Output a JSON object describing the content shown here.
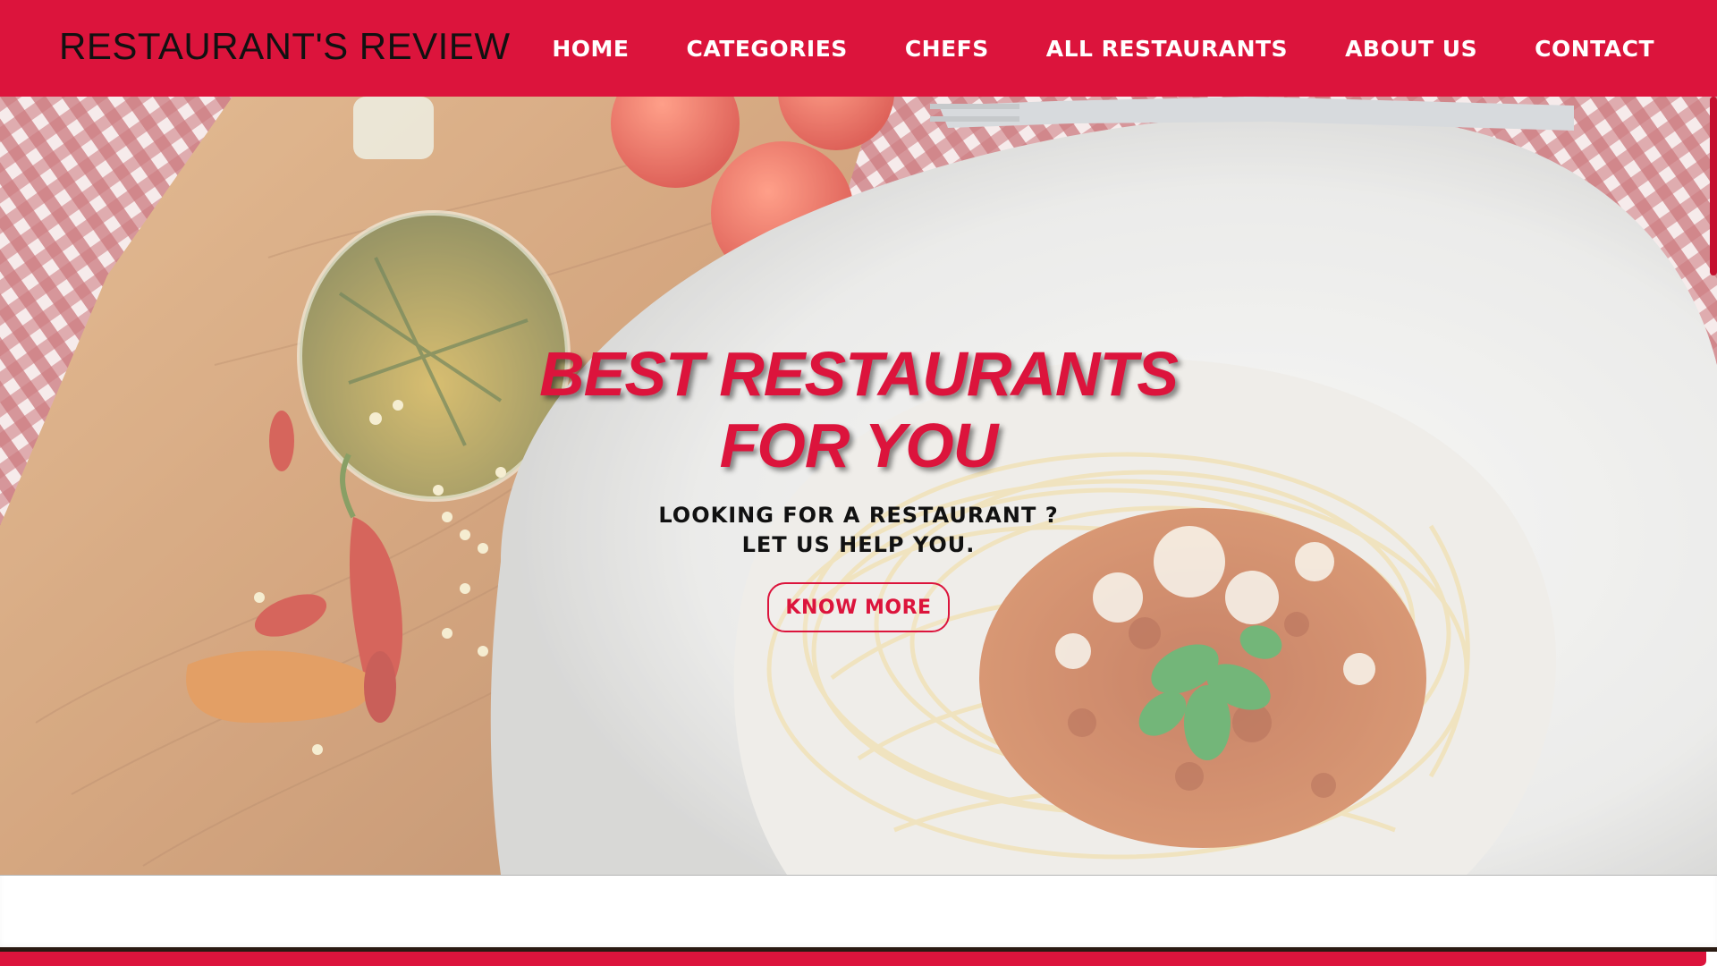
{
  "header": {
    "brand": "RESTAURANT'S REVIEW",
    "nav": [
      "HOME",
      "CATEGORIES",
      "CHEFS",
      "ALL RESTAURANTS",
      "ABOUT US",
      "CONTACT"
    ]
  },
  "hero": {
    "title_line1": "BEST RESTAURANTS",
    "title_line2": "FOR YOU",
    "subtitle_line1": "LOOKING FOR A RESTAURANT ?",
    "subtitle_line2": "LET US HELP YOU.",
    "cta_label": "KNOW MORE",
    "image_description_icons": [
      "checkered-cloth",
      "oil-bottle",
      "tomato",
      "chili-pepper",
      "spaghetti-plate",
      "fork"
    ]
  },
  "colors": {
    "brand": "#dc143c",
    "text_dark": "#111111",
    "white": "#ffffff"
  }
}
